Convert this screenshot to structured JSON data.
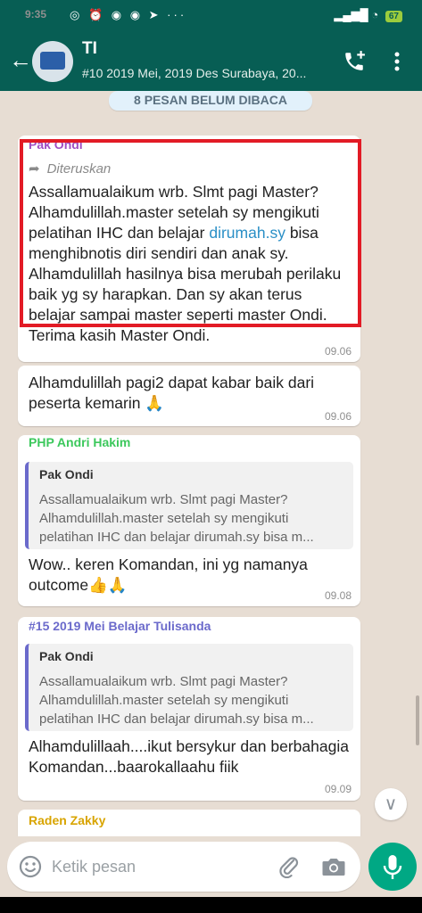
{
  "status_bar": {
    "time": "9:35",
    "battery": "67"
  },
  "header": {
    "title": "TI",
    "subtitle": "#10 2019 Mei, 2019 Des Surabaya, 20...",
    "back_icon": "arrow-left-icon",
    "call_icon": "add-call-icon",
    "menu_icon": "more-vert-icon"
  },
  "chat": {
    "unread_banner": "8 PESAN BELUM DIBACA",
    "messages": [
      {
        "sender": "Pak Ondi",
        "forwarded_label": "Diteruskan",
        "text_before_link": "Assallamualaikum wrb. Slmt pagi Master? Alhamdulillah.master setelah sy mengikuti pelatihan IHC dan belajar ",
        "link": "dirumah.sy",
        "text_after_link": " bisa menghibnotis diri sendiri dan anak sy. Alhamdulillah hasilnya bisa merubah perilaku baik yg sy harapkan. Dan sy akan terus belajar sampai master seperti master Ondi. Terima kasih Master Ondi.",
        "time": "09.06"
      },
      {
        "text": "Alhamdulillah pagi2 dapat kabar baik dari peserta kemarin 🙏",
        "time": "09.06"
      },
      {
        "sender": "PHP Andri Hakim",
        "quote_name": "Pak Ondi",
        "quote_lines": [
          "Assallamualaikum wrb. Slmt pagi Master?",
          "Alhamdulillah.master setelah sy mengikuti",
          "pelatihan IHC dan belajar dirumah.sy bisa m..."
        ],
        "text": "Wow.. keren Komandan, ini yg namanya outcome👍🙏",
        "time": "09.08"
      },
      {
        "sender": "#15 2019 Mei Belajar Tulisanda",
        "quote_name": "Pak Ondi",
        "quote_lines": [
          "Assallamualaikum wrb. Slmt pagi Master?",
          "Alhamdulillah.master setelah sy mengikuti",
          "pelatihan IHC dan belajar dirumah.sy bisa m..."
        ],
        "text": "Alhamdulillaah....ikut bersykur dan berbahagia Komandan...baarokallaahu fiik",
        "time": "09.09"
      },
      {
        "sender": "Raden Zakky"
      }
    ]
  },
  "input": {
    "placeholder": "Ketik pesan",
    "emoji_icon": "emoji-icon",
    "attach_icon": "paperclip-icon",
    "camera_icon": "camera-icon",
    "mic_icon": "microphone-icon"
  },
  "colors": {
    "header": "#075e54",
    "accent": "#00a884",
    "highlight_box": "#e21b25",
    "link": "#2a8fc6"
  }
}
